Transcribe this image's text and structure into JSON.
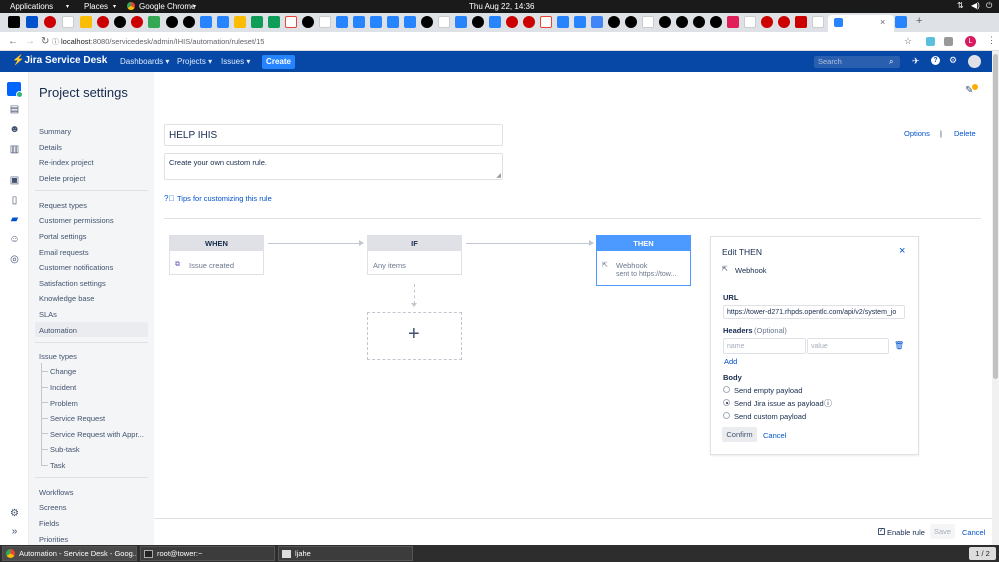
{
  "gnome": {
    "apps": "Applications",
    "places": "Places",
    "browser": "Google Chrome",
    "clock": "Thu Aug 22, 14:36"
  },
  "browser": {
    "url_host": "localhost",
    "url_path": ":8080/servicedesk/admin/IHIS/automation/ruleset/15",
    "active_tab_close": "×",
    "new_tab": "+"
  },
  "jira_nav": {
    "brand": "Jira Service Desk",
    "dashboards": "Dashboards",
    "projects": "Projects",
    "issues": "Issues",
    "create": "Create",
    "search_placeholder": "Search"
  },
  "page": {
    "title": "Project settings"
  },
  "sidebar": {
    "items": [
      "Summary",
      "Details",
      "Re-index project",
      "Delete project"
    ],
    "items2": [
      "Request types",
      "Customer permissions",
      "Portal settings",
      "Email requests",
      "Customer notifications",
      "Satisfaction settings",
      "Knowledge base",
      "SLAs",
      "Automation"
    ],
    "issue_types_heading": "Issue types",
    "issue_types": [
      "Change",
      "Incident",
      "Problem",
      "Service Request",
      "Service Request with Appr...",
      "Sub-task",
      "Task"
    ],
    "items3": [
      "Workflows",
      "Screens",
      "Fields",
      "Priorities"
    ]
  },
  "rule": {
    "name": "HELP IHIS",
    "description": "Create your own custom rule.",
    "tips_link": "Tips for customizing this rule",
    "options": "Options",
    "separator": "|",
    "delete": "Delete"
  },
  "flow": {
    "when": {
      "title": "WHEN",
      "content": "Issue created"
    },
    "if": {
      "title": "IF",
      "content": "Any items"
    },
    "then": {
      "title": "THEN",
      "content": "Webhook",
      "subtext": "sent to https://tow..."
    },
    "add_symbol": "+"
  },
  "edit_panel": {
    "title": "Edit THEN",
    "close": "×",
    "action": "Webhook",
    "url_label": "URL",
    "url_value": "https://tower-d271.rhpds.opentlc.com/api/v2/system_jo",
    "headers_label": "Headers",
    "headers_optional": "(Optional)",
    "name_placeholder": "name",
    "value_placeholder": "value",
    "add_link": "Add",
    "body_label": "Body",
    "body_options": [
      "Send empty payload",
      "Send Jira issue as payload",
      "Send custom payload"
    ],
    "body_selected": 1,
    "info_icon": "ⓘ",
    "confirm": "Confirm",
    "cancel": "Cancel"
  },
  "footer": {
    "enable_rule": "Enable rule",
    "save": "Save",
    "cancel": "Cancel"
  },
  "taskbar": {
    "chrome_task": "Automation - Service Desk - Goog...",
    "terminal_task": "root@tower:~",
    "other_task": "ljahe",
    "pages": "1 / 2"
  },
  "colors": {
    "jira_blue": "#0747a6",
    "then_blue": "#4c9aff",
    "link": "#0052cc",
    "sidebar_bg": "#f4f5f7"
  }
}
